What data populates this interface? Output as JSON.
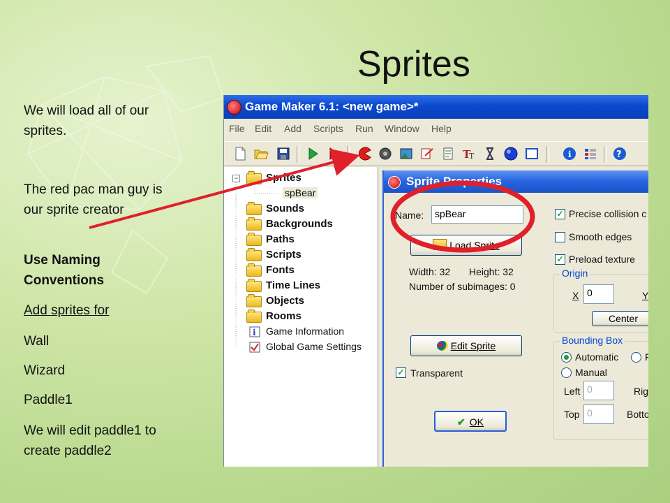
{
  "slide": {
    "title": "Sprites",
    "notes": [
      {
        "text": "We will load all of our sprites.",
        "style": "normal"
      },
      {
        "text": "The red pac man guy is our sprite creator",
        "style": "normal"
      },
      {
        "text": "Use Naming Conventions",
        "style": "bold"
      },
      {
        "text": "Add sprites for",
        "style": "underline"
      },
      {
        "text": "Wall",
        "style": "normal"
      },
      {
        "text": "Wizard",
        "style": "normal"
      },
      {
        "text": "Paddle1",
        "style": "normal"
      },
      {
        "text": "We will edit paddle1 to create paddle2",
        "style": "normal"
      }
    ],
    "colors": {
      "arrow": "#e0202a",
      "highlight_circle": "#e0202a"
    }
  },
  "window": {
    "title": "Game Maker 6.1: <new game>*",
    "menu": [
      "File",
      "Edit",
      "Add",
      "Scripts",
      "Run",
      "Window",
      "Help"
    ],
    "toolbar_icons": [
      "new-file-icon",
      "open-folder-icon",
      "save-icon",
      "run-icon",
      "run-debug-icon",
      "create-sprite-pacman-icon",
      "create-sound-icon",
      "create-background-icon",
      "create-path-icon",
      "create-script-icon",
      "create-font-icon",
      "create-timeline-icon",
      "create-object-icon",
      "create-room-icon",
      "game-information-icon",
      "global-settings-icon",
      "help-icon"
    ]
  },
  "tree": {
    "sprites_label": "Sprites",
    "sprite_child": "spBear",
    "folders": [
      "Sounds",
      "Backgrounds",
      "Paths",
      "Scripts",
      "Fonts",
      "Time Lines",
      "Objects",
      "Rooms"
    ],
    "game_information": "Game Information",
    "global_settings": "Global Game Settings"
  },
  "dialog": {
    "title": "Sprite Properties",
    "name_label": "Name:",
    "name_value": "spBear",
    "load_sprite": "Load Sprite",
    "width_text": "Width: 32",
    "height_text": "Height: 32",
    "subimages_text": "Number of subimages: 0",
    "edit_sprite": "Edit Sprite",
    "transparent_label": "Transparent",
    "transparent_checked": true,
    "ok": "OK",
    "precise_collision": "Precise collision c",
    "precise_checked": true,
    "smooth_edges": "Smooth edges",
    "smooth_checked": false,
    "preload_texture": "Preload texture",
    "preload_checked": true,
    "origin": {
      "title": "Origin",
      "x_label": "X",
      "x_value": "0",
      "y_label": "Y",
      "center": "Center"
    },
    "bounding_box": {
      "title": "Bounding Box",
      "automatic": "Automatic",
      "manual": "Manual",
      "selected": "automatic",
      "third_option": "F",
      "left_label": "Left",
      "left_value": "0",
      "right_label": "Rig",
      "top_label": "Top",
      "top_value": "0",
      "bottom_label": "Botto"
    }
  }
}
